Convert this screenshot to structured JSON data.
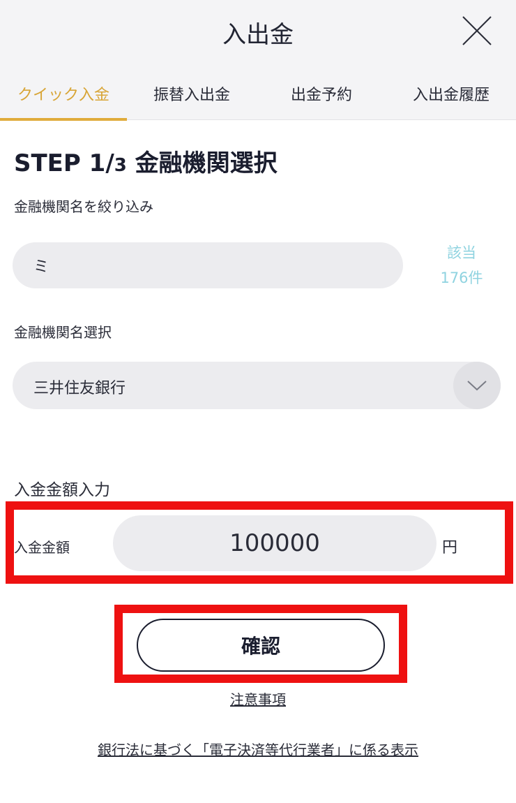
{
  "header": {
    "title": "入出金"
  },
  "tabs": [
    {
      "label": "クイック入金",
      "active": true
    },
    {
      "label": "振替入出金",
      "active": false
    },
    {
      "label": "出金予約",
      "active": false
    },
    {
      "label": "入出金履歴",
      "active": false
    }
  ],
  "colors": {
    "accent": "#e0ac3c",
    "highlight": "#ee1111",
    "count_text": "#8fd3e0",
    "input_bg": "#ececef"
  },
  "step": {
    "prefix": "STEP 1/",
    "number": "3",
    "title": " 金融機関選択"
  },
  "filter": {
    "label": "金融機関名を絞り込み",
    "value": "ミ",
    "count_label": "該当",
    "count_value": "176件"
  },
  "bank_select": {
    "label": "金融機関名選択",
    "selected": "三井住友銀行",
    "arrow_icon": "chevron-down-icon"
  },
  "amount": {
    "section_label": "入金金額入力",
    "field_label": "入金金額",
    "value": "100000",
    "unit": "円"
  },
  "actions": {
    "confirm_label": "確認",
    "notes_link": "注意事項",
    "disclosure_link": "銀行法に基づく「電子決済等代行業者」に係る表示"
  }
}
